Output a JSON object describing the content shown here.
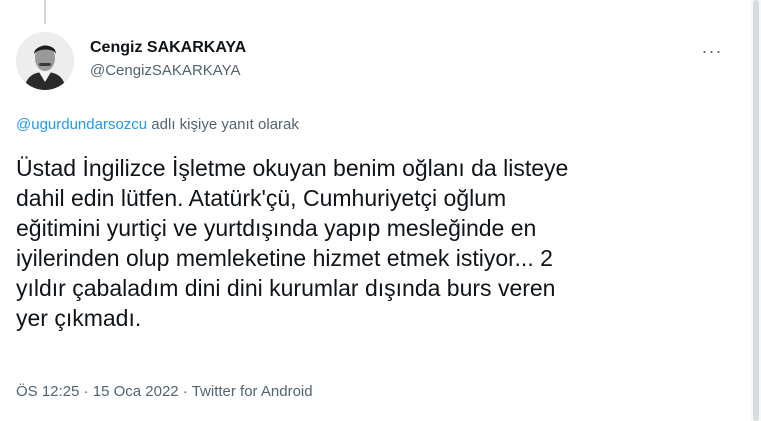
{
  "tweet": {
    "author": {
      "display_name": "Cengiz SAKARKAYA",
      "handle": "@CengizSAKARKAYA",
      "avatar_icon": "profile-photo"
    },
    "more_icon": "more-horizontal-icon",
    "more_label": "···",
    "reply": {
      "mention": "@ugurdundarsozcu",
      "suffix": " adlı kişiye yanıt olarak"
    },
    "text": "Üstad İngilizce İşletme okuyan benim oğlanı da listeye\ndahil edin lütfen. Atatürk'çü, Cumhuriyetçi oğlum\neğitimini yurtiçi ve yurtdışında yapıp mesleğinde en\niyilerinden olup memleketine hizmet etmek istiyor... 2\nyıldır çabaladım dini dini kurumlar dışında burs veren\nyer çıkmadı.",
    "meta": {
      "time": "ÖS 12:25",
      "separator": " · ",
      "date": "15 Oca 2022",
      "source": "Twitter for Android"
    }
  },
  "colors": {
    "link": "#1d9bf0",
    "secondary_text": "#536471",
    "primary_text": "#0f1419"
  }
}
